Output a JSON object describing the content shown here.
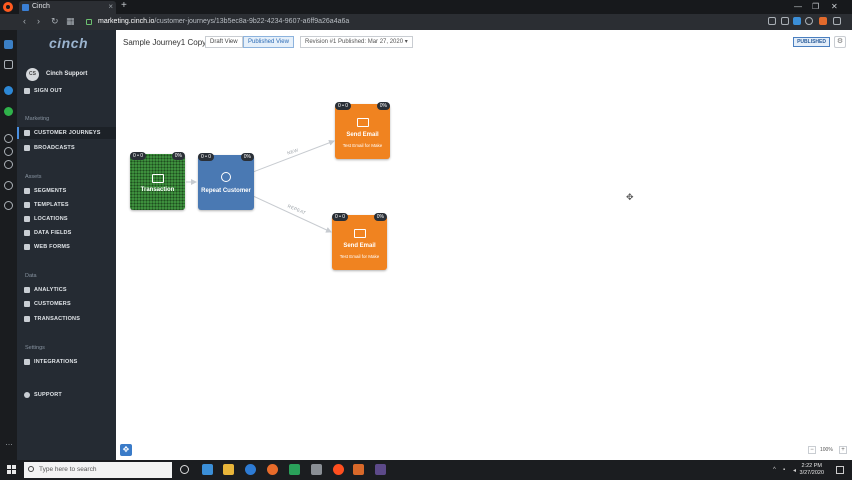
{
  "browser": {
    "tab_title": "Cinch",
    "url_host": "marketing.cinch.io",
    "url_path": "/customer-journeys/13b5ec8a-9b22-4234-9607-a6ff9a26a4a6a"
  },
  "app": {
    "brand": "cinch",
    "user": {
      "initials": "CS",
      "name": "Cinch Support"
    },
    "nav": {
      "sign_out": "SIGN OUT",
      "sections": {
        "marketing": "Marketing",
        "assets": "Assets",
        "data": "Data",
        "settings": "Settings"
      },
      "items": {
        "customer_journeys": "CUSTOMER JOURNEYS",
        "broadcasts": "BROADCASTS",
        "segments": "SEGMENTS",
        "templates": "TEMPLATES",
        "locations": "LOCATIONS",
        "data_fields": "DATA FIELDS",
        "web_forms": "WEB FORMS",
        "analytics": "ANALYTICS",
        "customers": "CUSTOMERS",
        "transactions": "TRANSACTIONS",
        "integrations": "INTEGRATIONS",
        "support": "SUPPORT"
      }
    }
  },
  "header": {
    "journey_title": "Sample Journey1 Copy",
    "draft_view": "Draft View",
    "published_view": "Published View",
    "revision": "Revision #1 Published: Mar 27, 2020",
    "status_badge": "PUBLISHED"
  },
  "canvas": {
    "nodes": {
      "transaction": {
        "label": "Transaction",
        "count": "0 • 0",
        "pct": "0%"
      },
      "repeat_customer": {
        "label": "Repeat Customer",
        "count": "0 • 0",
        "pct": "0%"
      },
      "email_new": {
        "label": "Send Email",
        "sub": "Test Email for Make",
        "count": "0 • 0",
        "pct": "0%"
      },
      "email_repeat": {
        "label": "Send Email",
        "sub": "Test Email for Make",
        "count": "0 • 0",
        "pct": "0%"
      }
    },
    "edges": {
      "new": "NEW",
      "repeat": "REPEAT"
    },
    "zoom": "100%"
  },
  "taskbar": {
    "search_placeholder": "Type here to search",
    "time": "2:22 PM",
    "date": "3/27/2020"
  },
  "colors": {
    "nav_bg": "#252b33",
    "accent_blue": "#4a90e2",
    "node_green": "#3d8f3d",
    "node_blue": "#4a79b3",
    "node_orange": "#f08320"
  }
}
